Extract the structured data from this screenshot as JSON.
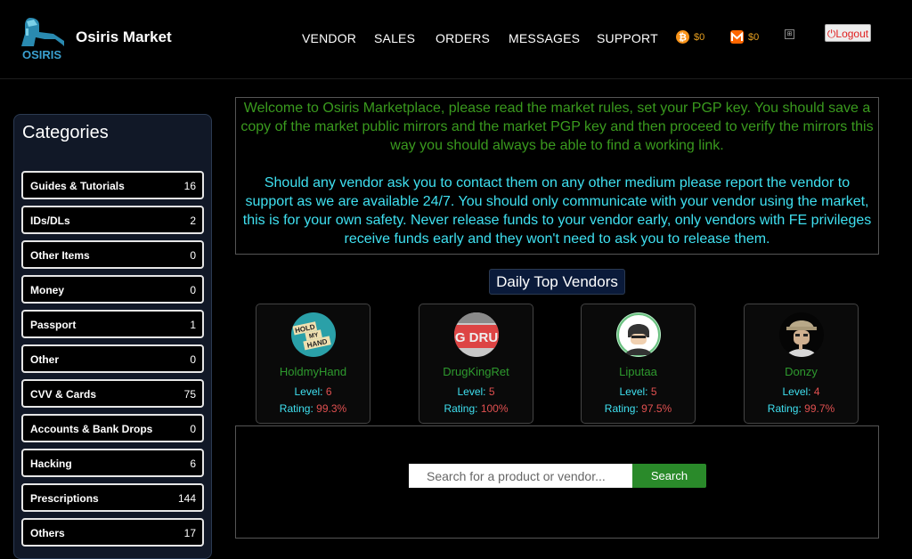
{
  "header": {
    "brand": "Osiris Market",
    "logo_text": "OSIRIS",
    "nav": [
      "VENDOR",
      "SALES",
      "ORDERS",
      "MESSAGES",
      "SUPPORT"
    ],
    "btc_balance": "$0",
    "xmr_balance": "$0",
    "logout_label": "Logout",
    "colors": {
      "btc": "#f7931a",
      "xmr": "#ff6600",
      "bal": "#e8a020"
    }
  },
  "sidebar": {
    "title": "Categories",
    "items": [
      {
        "label": "Guides & Tutorials",
        "count": "16"
      },
      {
        "label": "IDs/DLs",
        "count": "2"
      },
      {
        "label": "Other Items",
        "count": "0"
      },
      {
        "label": "Money",
        "count": "0"
      },
      {
        "label": "Passport",
        "count": "1"
      },
      {
        "label": "Other",
        "count": "0"
      },
      {
        "label": "CVV & Cards",
        "count": "75"
      },
      {
        "label": "Accounts & Bank Drops",
        "count": "0"
      },
      {
        "label": "Hacking",
        "count": "6"
      },
      {
        "label": "Prescriptions",
        "count": "144"
      },
      {
        "label": "Others",
        "count": "17"
      }
    ]
  },
  "welcome": {
    "p1": "Welcome to Osiris Marketplace, please read the market rules, set your PGP key. You should save a copy of the market public mirrors and the market PGP key and then proceed to verify the mirrors this way you should always be able to find a working link.",
    "p2": "Should any vendor ask you to contact them on any other medium please report the vendor to support as we are available 24/7. You should only communicate with your vendor using the market, this is for your own safety. Never release funds to your vendor early, only vendors with FE privileges receive funds early and they won't need to ask you to release them."
  },
  "top_vendors": {
    "title": "Daily Top Vendors",
    "level_label": "Level:",
    "rating_label": "Rating:",
    "vendors": [
      {
        "name": "HoldmyHand",
        "level": "6",
        "rating": "99.3%",
        "avatar_text": [
          "HOLD",
          "MY",
          "HAND"
        ]
      },
      {
        "name": "DrugKingRet",
        "level": "5",
        "rating": "100%",
        "avatar_text": [
          "G DRU"
        ]
      },
      {
        "name": "Liputaa",
        "level": "5",
        "rating": "97.5%"
      },
      {
        "name": "Donzy",
        "level": "4",
        "rating": "99.7%"
      }
    ]
  },
  "search": {
    "placeholder": "Search for a product or vendor...",
    "button": "Search"
  }
}
